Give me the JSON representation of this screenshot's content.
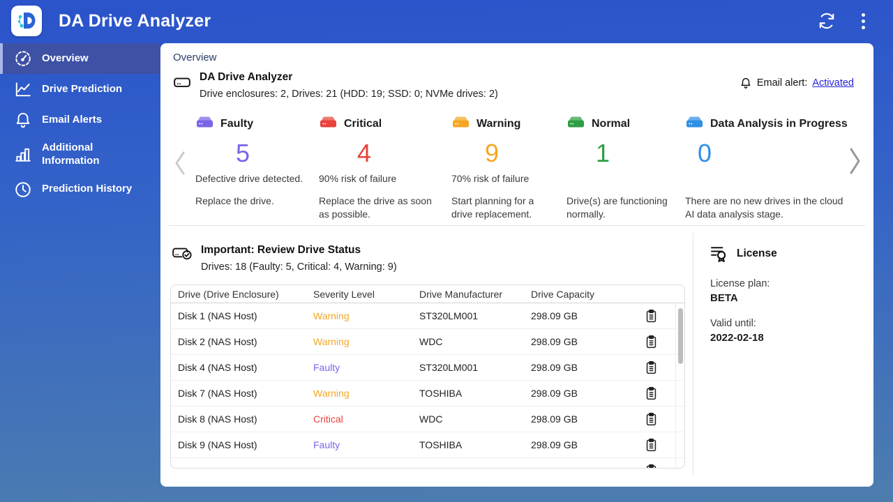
{
  "topbar": {
    "title": "DA Drive Analyzer",
    "icons": [
      "app-logo",
      "refresh-icon",
      "kebab-menu-icon"
    ]
  },
  "sidebar": {
    "items": [
      {
        "label": "Overview",
        "icon": "gauge-icon",
        "selected": true
      },
      {
        "label": "Drive Prediction",
        "icon": "line-chart-icon",
        "selected": false
      },
      {
        "label": "Email Alerts",
        "icon": "bell-icon",
        "selected": false
      },
      {
        "label": "Additional Information",
        "icon": "bar-chart-icon",
        "selected": false
      },
      {
        "label": "Prediction History",
        "icon": "clock-icon",
        "selected": false
      }
    ]
  },
  "main": {
    "tab_label": "Overview",
    "summary": {
      "title": "DA Drive Analyzer",
      "subtitle": "Drive enclosures: 2, Drives: 21 (HDD: 19; SSD: 0; NVMe drives: 2)",
      "email_alert_label": "Email alert:",
      "email_alert_value": "Activated"
    },
    "status_cards": [
      {
        "label": "Faulty",
        "count": "5",
        "color": "#7c64e8",
        "risk": "Defective drive detected.",
        "action": "Replace the drive."
      },
      {
        "label": "Critical",
        "count": "4",
        "color": "#e8433b",
        "risk": "90% risk of failure",
        "action": "Replace the drive as soon as possible."
      },
      {
        "label": "Warning",
        "count": "9",
        "color": "#f5a623",
        "risk": "70% risk of failure",
        "action": "Start planning for a drive replacement."
      },
      {
        "label": "Normal",
        "count": "1",
        "color": "#2e9e44",
        "risk": "",
        "action": "Drive(s) are functioning normally."
      },
      {
        "label": "Data Analysis in Progress",
        "count": "0",
        "color": "#2f8fe5",
        "risk": "",
        "action": "There are no new drives in the cloud AI data analysis stage."
      }
    ],
    "review": {
      "title": "Important: Review Drive Status",
      "subtitle": "Drives: 18 (Faulty: 5, Critical: 4, Warning: 9)",
      "table": {
        "columns": [
          "Drive (Drive Enclosure)",
          "Severity Level",
          "Drive Manufacturer",
          "Drive Capacity"
        ],
        "rows": [
          {
            "drive": "Disk 1 (NAS Host)",
            "severity": "Warning",
            "manufacturer": "ST320LM001",
            "capacity": "298.09 GB"
          },
          {
            "drive": "Disk 2 (NAS Host)",
            "severity": "Warning",
            "manufacturer": "WDC",
            "capacity": "298.09 GB"
          },
          {
            "drive": "Disk 4 (NAS Host)",
            "severity": "Faulty",
            "manufacturer": "ST320LM001",
            "capacity": "298.09 GB"
          },
          {
            "drive": "Disk 7 (NAS Host)",
            "severity": "Warning",
            "manufacturer": "TOSHIBA",
            "capacity": "298.09 GB"
          },
          {
            "drive": "Disk 8 (NAS Host)",
            "severity": "Critical",
            "manufacturer": "WDC",
            "capacity": "298.09 GB"
          },
          {
            "drive": "Disk 9 (NAS Host)",
            "severity": "Faulty",
            "manufacturer": "TOSHIBA",
            "capacity": "298.09 GB"
          }
        ]
      }
    },
    "license": {
      "title": "License",
      "plan_label": "License plan:",
      "plan_value": "BETA",
      "valid_label": "Valid until:",
      "valid_value": "2022-02-18"
    }
  },
  "colors": {
    "topbar_blue": "#2b53ca",
    "sidebar_selected": "#3d51a5",
    "link_blue": "#2323d8",
    "severity": {
      "faulty": "#7c64e8",
      "critical": "#e8433b",
      "warning": "#f5a623",
      "normal": "#2e9e44"
    }
  }
}
